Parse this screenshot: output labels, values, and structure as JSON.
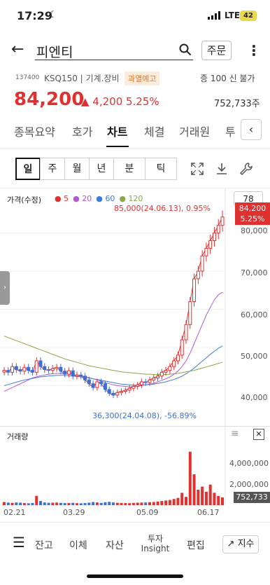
{
  "status": {
    "time": "17:29",
    "network": "LTE",
    "battery": "42"
  },
  "header": {
    "title": "피엔티",
    "order_label": "주문"
  },
  "stock": {
    "code": "137400",
    "info": "KSQ150 | 기계.장비",
    "warning": "과열예고",
    "volume_label": "증 100  신 불가",
    "price": "84,200",
    "change": "▲ 4,200",
    "change_pct": "5.25%",
    "trade_volume": "752,733주"
  },
  "tabs": [
    "종목요약",
    "호가",
    "차트",
    "체결",
    "거래원",
    "투"
  ],
  "active_tab": "차트",
  "periods": [
    "일",
    "주",
    "월",
    "년",
    "분",
    "틱"
  ],
  "selected_period": "일",
  "chart": {
    "label": "가격(수정)",
    "ma_legend": [
      {
        "label": "5",
        "color": "#e03131"
      },
      {
        "label": "20",
        "color": "#b05ad8"
      },
      {
        "label": "60",
        "color": "#3b7ddd"
      },
      {
        "label": "120",
        "color": "#8aa84a"
      }
    ],
    "hint_value": "78",
    "high_annotation": "85,000(24.06.13), 0.95%",
    "low_annotation": "36,300(24.04.08), -56.89%",
    "current_price_tag": "84,200",
    "current_pct_tag": "5.25%",
    "volume_title": "거래량",
    "volume_tag": "752,733",
    "colors": {
      "up": "#e03131",
      "down": "#3b6fd6"
    }
  },
  "chart_data": {
    "type": "candlestick",
    "y_ticks": [
      "80,000",
      "70,000",
      "60,000",
      "50,000",
      "40,000"
    ],
    "ylim": [
      32000,
      88000
    ],
    "volume_ticks": [
      "4,000,000",
      "2,000,000"
    ],
    "volume_ylim": [
      0,
      6000000
    ],
    "x_ticks": [
      "02.21",
      "03.29",
      "05.09",
      "06.17"
    ],
    "close_series": [
      44000,
      43500,
      45000,
      44200,
      43800,
      44800,
      44000,
      43500,
      46500,
      45000,
      44200,
      44000,
      44500,
      44800,
      43800,
      43000,
      43900,
      42500,
      42800,
      42500,
      41500,
      40500,
      39500,
      41000,
      40500,
      39000,
      38000,
      37500,
      38200,
      38500,
      38800,
      39300,
      39800,
      40200,
      41000,
      40800,
      41500,
      42000,
      42500,
      43500,
      44000,
      45000,
      46500,
      48000,
      52000,
      56000,
      62000,
      68000,
      70000,
      74000,
      76000,
      78000,
      80000,
      82000,
      84200
    ],
    "volume_series": [
      300000,
      250000,
      220000,
      260000,
      240000,
      200000,
      180000,
      210000,
      900000,
      400000,
      260000,
      230000,
      240000,
      250000,
      220000,
      200000,
      210000,
      230000,
      190000,
      180000,
      200000,
      240000,
      300000,
      260000,
      220000,
      280000,
      320000,
      260000,
      230000,
      210000,
      200000,
      190000,
      220000,
      240000,
      250000,
      260000,
      280000,
      300000,
      350000,
      400000,
      450000,
      500000,
      600000,
      700000,
      1200000,
      800000,
      5200000,
      3000000,
      1500000,
      1800000,
      1300000,
      2000000,
      1200000,
      900000,
      752733
    ],
    "series": [
      {
        "name": "5",
        "values": [
          44000,
          43500,
          45000,
          44200,
          43800,
          44800,
          44000,
          43500,
          46500,
          45000,
          44200,
          44000,
          44500,
          44800,
          43800,
          43000,
          43900,
          42500,
          42800,
          42500,
          41500,
          40500,
          39500,
          41000,
          40500,
          39000,
          38000,
          37500,
          38200,
          38500,
          38800,
          39300,
          39800,
          40200,
          41000,
          40800,
          41500,
          42000,
          42500,
          43500,
          44000,
          45000,
          46500,
          48000,
          52000,
          56000,
          62000,
          68000,
          70000,
          74000,
          76000,
          78000,
          80000,
          82000,
          84200
        ]
      },
      {
        "name": "20",
        "values": [
          38500,
          39000,
          39500,
          40000,
          40500,
          41000,
          41500,
          42000,
          42300,
          42600,
          42800,
          43000,
          43100,
          43200,
          43200,
          43100,
          43000,
          42900,
          42700,
          42500,
          42300,
          42100,
          41800,
          41500,
          41200,
          40800,
          40500,
          40200,
          40000,
          39900,
          39800,
          39700,
          39700,
          39800,
          40000,
          40200,
          40400,
          40600,
          41000,
          41400,
          41800,
          42300,
          43000,
          43800,
          45000,
          46500,
          48500,
          51000,
          53500,
          56000,
          58500,
          60500,
          62500,
          63800,
          64500
        ]
      },
      {
        "name": "60",
        "values": [
          40000,
          40300,
          40600,
          40900,
          41200,
          41500,
          41700,
          41900,
          42100,
          42300,
          42400,
          42500,
          42600,
          42700,
          42700,
          42700,
          42600,
          42500,
          42400,
          42300,
          42200,
          42000,
          41800,
          41600,
          41400,
          41200,
          41000,
          40800,
          40600,
          40400,
          40300,
          40200,
          40100,
          40100,
          40100,
          40200,
          40300,
          40400,
          40600,
          40800,
          41000,
          41300,
          41600,
          42000,
          42500,
          43100,
          43800,
          44600,
          45500,
          46400,
          47300,
          48200,
          49000,
          49800,
          50400
        ]
      },
      {
        "name": "120",
        "values": [
          53000,
          52600,
          52200,
          51800,
          51400,
          51000,
          50600,
          50200,
          49800,
          49400,
          49000,
          48600,
          48200,
          47800,
          47400,
          47000,
          46700,
          46400,
          46100,
          45800,
          45500,
          45200,
          45000,
          44800,
          44600,
          44400,
          44200,
          44000,
          43800,
          43600,
          43500,
          43400,
          43300,
          43200,
          43100,
          43000,
          43000,
          42900,
          42900,
          42900,
          42900,
          43000,
          43100,
          43200,
          43400,
          43600,
          43800,
          44000,
          44300,
          44600,
          44900,
          45200,
          45500,
          45800,
          46100
        ]
      }
    ]
  },
  "bottom_nav": [
    "잔고",
    "이체",
    "자산",
    "투자\nInsight",
    "편집",
    "지수"
  ]
}
